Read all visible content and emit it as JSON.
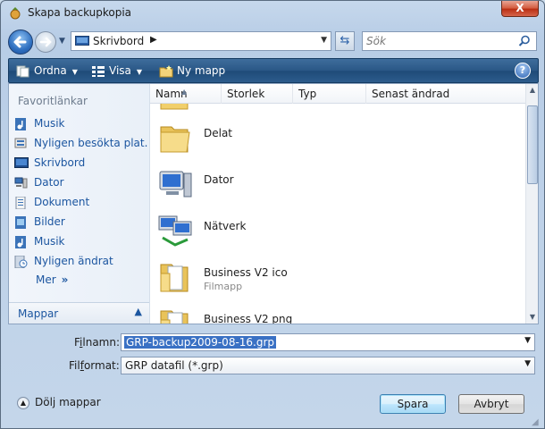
{
  "window": {
    "title": "Skapa backupkopia",
    "close_label": "X"
  },
  "address": {
    "location": "Skrivbord",
    "search_placeholder": "Sök"
  },
  "toolbar": {
    "organize": "Ordna",
    "view": "Visa",
    "new_folder": "Ny mapp",
    "help": "?"
  },
  "navpane": {
    "favorites_heading": "Favoritlänkar",
    "items": [
      {
        "label": "Musik",
        "icon": "music-icon"
      },
      {
        "label": "Nyligen besökta plat...",
        "icon": "recent-places-icon"
      },
      {
        "label": "Skrivbord",
        "icon": "desktop-icon"
      },
      {
        "label": "Dator",
        "icon": "computer-icon"
      },
      {
        "label": "Dokument",
        "icon": "documents-icon"
      },
      {
        "label": "Bilder",
        "icon": "pictures-icon"
      },
      {
        "label": "Musik",
        "icon": "music-icon"
      },
      {
        "label": "Nyligen ändrat",
        "icon": "recently-changed-icon"
      }
    ],
    "more": "Mer",
    "folders": "Mappar"
  },
  "filelist": {
    "columns": [
      "Namn",
      "Storlek",
      "Typ",
      "Senast ändrad"
    ],
    "rows": [
      {
        "name": "Delat",
        "sub": "",
        "icon": "folder-icon"
      },
      {
        "name": "Dator",
        "sub": "",
        "icon": "computer-icon"
      },
      {
        "name": "Nätverk",
        "sub": "",
        "icon": "network-icon"
      },
      {
        "name": "Business V2 ico",
        "sub": "Filmapp",
        "icon": "folder-open-icon"
      },
      {
        "name": "Business V2 png",
        "sub": "",
        "icon": "folder-open-icon"
      }
    ]
  },
  "form": {
    "filename_label_pre": "F",
    "filename_label_u": "i",
    "filename_label_post": "lnamn:",
    "filename_value": "GRP-backup2009-08-16.grp",
    "format_label_pre": "Fil",
    "format_label_u": "f",
    "format_label_post": "ormat:",
    "format_value": "GRP datafil (*.grp)",
    "hide_folders": "Dölj mappar",
    "save": "Spara",
    "cancel": "Avbryt"
  },
  "colors": {
    "toolbar": "#2a5786",
    "link": "#1c56a0",
    "selection": "#3a71c4"
  }
}
